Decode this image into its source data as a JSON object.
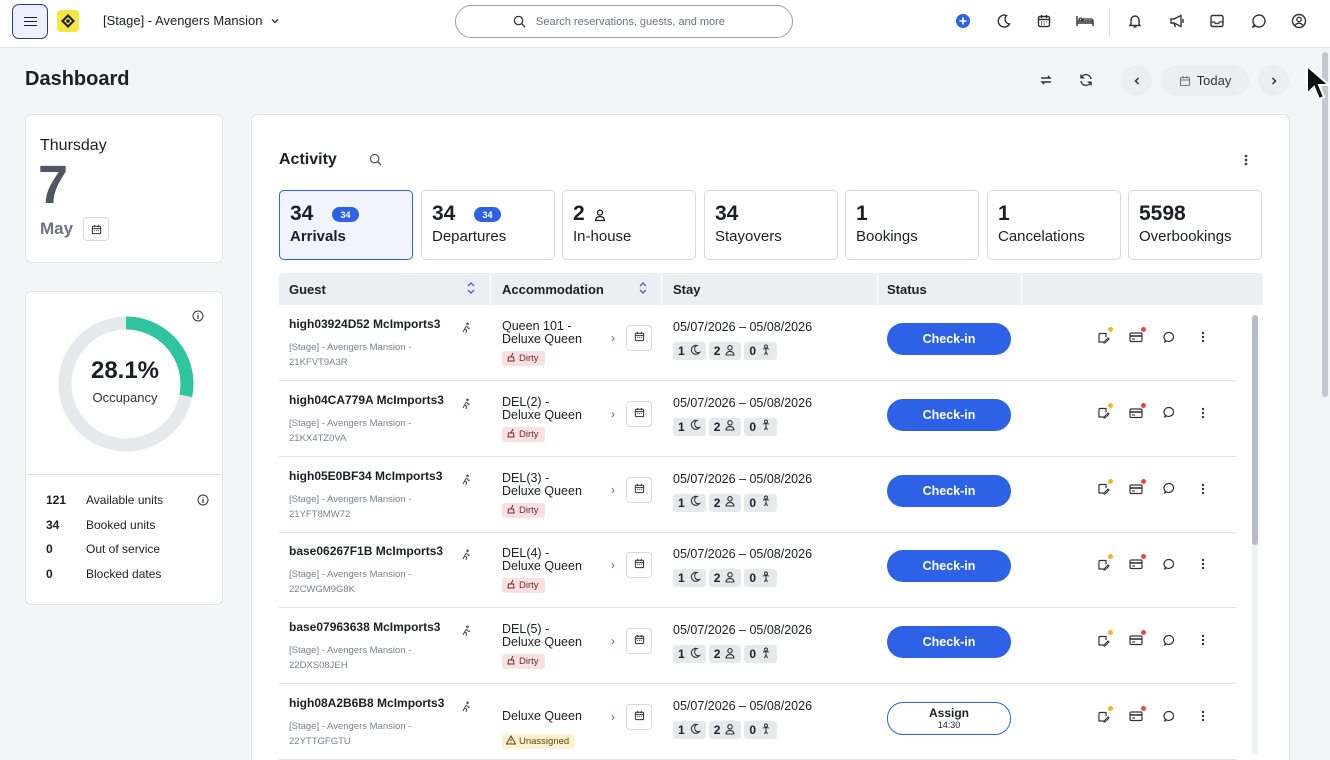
{
  "topbar": {
    "property": "[Stage] - Avengers Mansion",
    "search_placeholder": "Search reservations, guests, and more"
  },
  "header": {
    "title": "Dashboard",
    "today_label": "Today"
  },
  "date_card": {
    "weekday": "Thursday",
    "day": "7",
    "month": "May"
  },
  "occupancy": {
    "percent_label": "28.1%",
    "percent_value": 28.1,
    "label": "Occupancy",
    "accent_color": "#2fc3a0",
    "stats": [
      {
        "value": "121",
        "label": "Available units"
      },
      {
        "value": "34",
        "label": "Booked units"
      },
      {
        "value": "0",
        "label": "Out of service"
      },
      {
        "value": "0",
        "label": "Blocked dates"
      }
    ]
  },
  "activity": {
    "title": "Activity",
    "tabs": [
      {
        "count": "34",
        "badge": "34",
        "label": "Arrivals"
      },
      {
        "count": "34",
        "badge": "34",
        "label": "Departures"
      },
      {
        "count": "2",
        "label": "In-house"
      },
      {
        "count": "34",
        "label": "Stayovers"
      },
      {
        "count": "1",
        "label": "Bookings"
      },
      {
        "count": "1",
        "label": "Cancelations"
      },
      {
        "count": "5598",
        "label": "Overbookings"
      }
    ],
    "columns": [
      "Guest",
      "Accommodation",
      "Stay",
      "Status"
    ],
    "rows": [
      {
        "guest": "high03924D52 McImports3",
        "property": "[Stage] - Avengers Mansion -",
        "code": "21KFVT9A3R",
        "acc1": "Queen 101 -",
        "acc2": "Deluxe Queen",
        "tag": "Dirty",
        "dates": "05/07/2026 – 05/08/2026",
        "nights": "1",
        "adults": "2",
        "children": "0",
        "status": "Check-in"
      },
      {
        "guest": "high04CA779A McImports3",
        "property": "[Stage] - Avengers Mansion -",
        "code": "21KX4TZ0VA",
        "acc1": "DEL(2) -",
        "acc2": "Deluxe Queen",
        "tag": "Dirty",
        "dates": "05/07/2026 – 05/08/2026",
        "nights": "1",
        "adults": "2",
        "children": "0",
        "status": "Check-in"
      },
      {
        "guest": "high05E0BF34 McImports3",
        "property": "[Stage] - Avengers Mansion -",
        "code": "21YFT8MW72",
        "acc1": "DEL(3) -",
        "acc2": "Deluxe Queen",
        "tag": "Dirty",
        "dates": "05/07/2026 – 05/08/2026",
        "nights": "1",
        "adults": "2",
        "children": "0",
        "status": "Check-in"
      },
      {
        "guest": "base06267F1B McImports3",
        "property": "[Stage] - Avengers Mansion -",
        "code": "22CWGM9G8K",
        "acc1": "DEL(4) -",
        "acc2": "Deluxe Queen",
        "tag": "Dirty",
        "dates": "05/07/2026 – 05/08/2026",
        "nights": "1",
        "adults": "2",
        "children": "0",
        "status": "Check-in"
      },
      {
        "guest": "base07963638 McImports3",
        "property": "[Stage] - Avengers Mansion -",
        "code": "22DXS08JEH",
        "acc1": "DEL(5) -",
        "acc2": "Deluxe Queen",
        "tag": "Dirty",
        "dates": "05/07/2026 – 05/08/2026",
        "nights": "1",
        "adults": "2",
        "children": "0",
        "status": "Check-in"
      },
      {
        "guest": "high08A2B6B8 McImports3",
        "property": "[Stage] - Avengers Mansion -",
        "code": "22YTTGFGTU",
        "acc1": "Deluxe Queen",
        "acc2": "",
        "tag": "Unassigned",
        "dates": "05/07/2026 – 05/08/2026",
        "nights": "1",
        "adults": "2",
        "children": "0",
        "status": "Assign",
        "status_sub": "14:30"
      }
    ]
  },
  "colors": {
    "primary": "#2d62e6",
    "dirty_bg": "#fbe0e2",
    "unassigned_bg": "#fdf1cf",
    "note_dot": "#f2b61f",
    "alert_dot": "#e5484d"
  }
}
